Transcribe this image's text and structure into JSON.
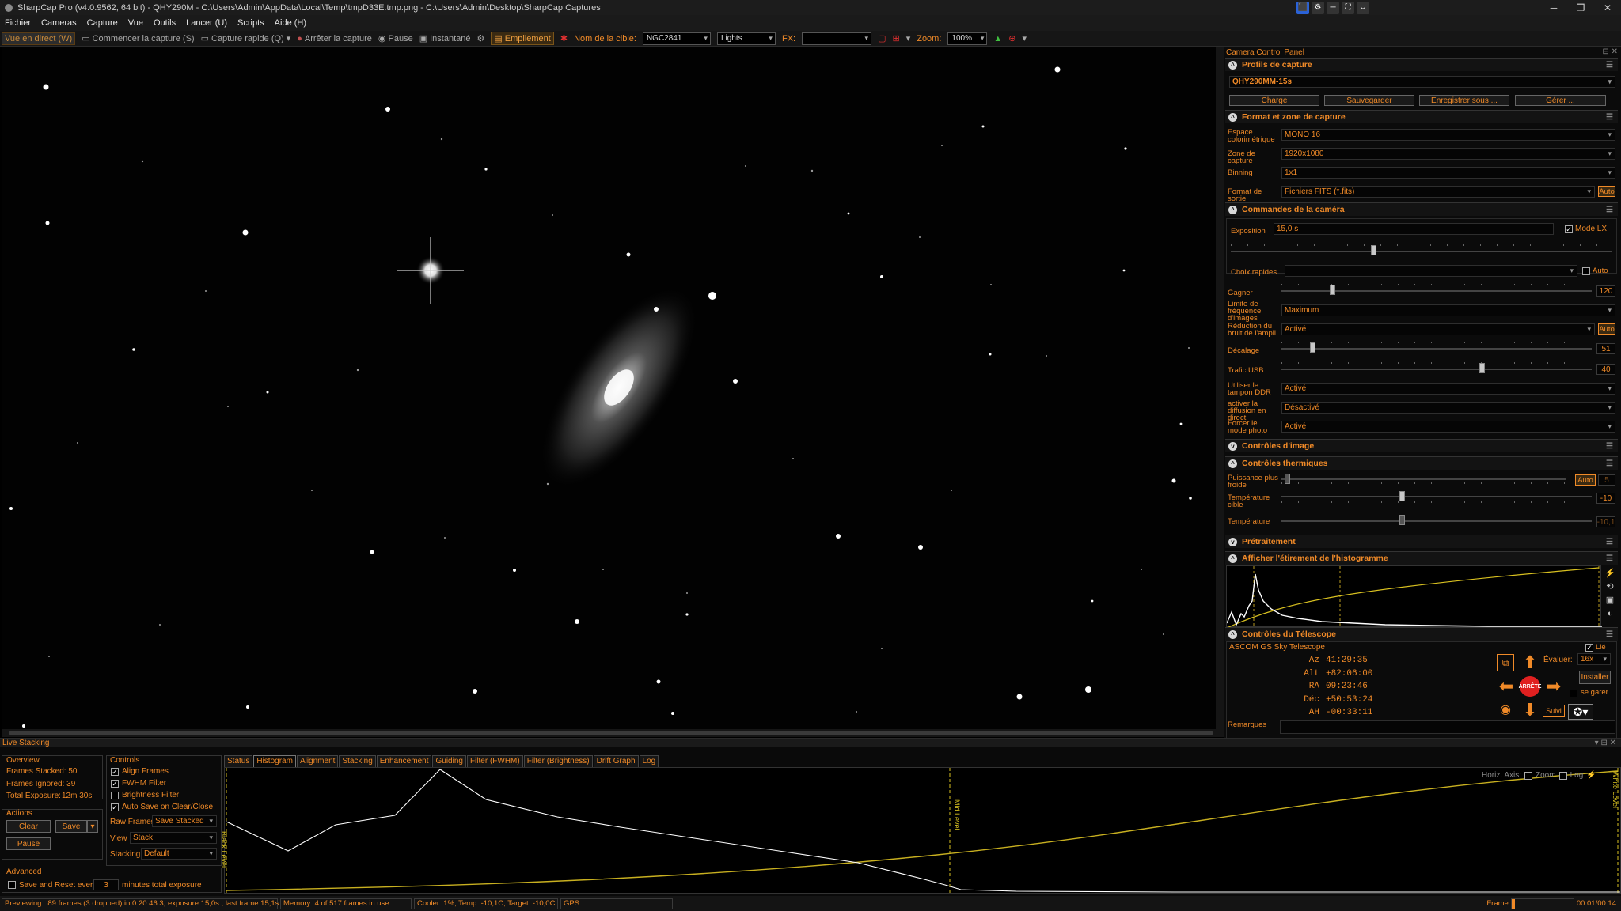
{
  "window": {
    "title": "SharpCap Pro (v4.0.9562, 64 bit) - QHY290M - C:\\Users\\Admin\\AppData\\Local\\Temp\\tmpD33E.tmp.png - C:\\Users\\Admin\\Desktop\\SharpCap Captures",
    "minimize": "─",
    "restore": "❐",
    "close": "✕"
  },
  "tray": [
    "⬛",
    "⚙",
    "─",
    "⛶",
    "⌄"
  ],
  "menu": [
    "Fichier",
    "Cameras",
    "Capture",
    "Vue",
    "Outils",
    "Lancer (U)",
    "Scripts",
    "Aide (H)"
  ],
  "toolbar": {
    "live_view": "Vue en direct (W)",
    "start_capture": "Commencer la capture (S)",
    "quick_capture": "Capture rapide (Q)",
    "stop_capture": "Arrêter la capture",
    "pause": "Pause",
    "snapshot": "Instantané",
    "stacking": "Empilement",
    "target_label": "Nom de la cible:",
    "target_value": "NGC2841",
    "frame_type": "Lights",
    "fx_label": "FX:",
    "fx_value": "",
    "zoom_label": "Zoom:",
    "zoom_value": "100%"
  },
  "panel": {
    "title": "Camera Control Panel",
    "profiles": {
      "header": "Profils de capture",
      "selected": "QHY290MM-15s",
      "buttons": [
        "Charge",
        "Sauvegarder",
        "Enregistrer sous ...",
        "Gérer ..."
      ]
    },
    "format": {
      "header": "Format et zone de capture",
      "rows": [
        {
          "label": "Espace colorimétrique",
          "value": "MONO 16"
        },
        {
          "label": "Zone de capture",
          "value": "1920x1080"
        },
        {
          "label": "Binning",
          "value": "1x1"
        },
        {
          "label": "Format de sortie",
          "value": "Fichiers FITS (*.fits)"
        }
      ],
      "auto": "Auto"
    },
    "camera": {
      "header": "Commandes de la caméra",
      "exposure_label": "Exposition",
      "exposure_value": "15,0 s",
      "lx_label": "Mode LX",
      "quick_label": "Choix rapides",
      "quick_auto": "Auto",
      "gain_label": "Gagner",
      "gain_value": "120",
      "framerate_label": "Limite de fréquence d'images",
      "framerate_value": "Maximum",
      "ampnoise_label": "Réduction du bruit de l'ampli",
      "ampnoise_value": "Activé",
      "ampnoise_auto": "Auto",
      "offset_label": "Décalage",
      "offset_value": "51",
      "usb_label": "Trafic USB",
      "usb_value": "40",
      "ddr_label": "Utiliser le tampon DDR",
      "ddr_value": "Activé",
      "stream_label": "activer la diffusion en direct",
      "stream_value": "Désactivé",
      "photo_label": "Forcer le mode photo",
      "photo_value": "Activé"
    },
    "image_controls": {
      "header": "Contrôles d'image"
    },
    "thermal": {
      "header": "Contrôles thermiques",
      "power_label": "Puissance plus froide",
      "power_auto": "Auto",
      "power_value": "5",
      "target_label": "Température cible",
      "target_value": "-10",
      "temp_label": "Température",
      "temp_value": "-10,1"
    },
    "preprocessing": {
      "header": "Prétraitement"
    },
    "histogram": {
      "header": "Afficher l'étirement de l'histogramme"
    },
    "telescope": {
      "header": "Contrôles du Télescope",
      "name": "ASCOM GS Sky Telescope",
      "linked": "Lié",
      "coords": [
        {
          "k": "Az",
          "v": "41:29:35"
        },
        {
          "k": "Alt",
          "v": "+82:06:00"
        },
        {
          "k": "RA",
          "v": "09:23:46"
        },
        {
          "k": "Déc",
          "v": "+50:53:24"
        },
        {
          "k": "AH",
          "v": "-00:33:11"
        }
      ],
      "rate_label": "Évaluer:",
      "rate_value": "16x",
      "install": "Installer",
      "park": "se garer",
      "stop": "ARRÊTE",
      "follow": "Suivi"
    },
    "remarks": "Remarques"
  },
  "live_stacking": {
    "title": "Live Stacking",
    "overview": {
      "header": "Overview",
      "stacked": "Frames Stacked: 50",
      "ignored": "Frames Ignored: 39",
      "exposure_label": "Total Exposure:",
      "exposure_value": "12m 30s"
    },
    "actions": {
      "header": "Actions",
      "clear": "Clear",
      "save": "Save",
      "pause": "Pause"
    },
    "advanced": {
      "header": "Advanced",
      "save_every": "Save and Reset every",
      "minutes_value": "3",
      "minutes": "minutes total exposure"
    },
    "controls": {
      "header": "Controls",
      "align": "Align Frames",
      "fwhm": "FWHM Filter",
      "brightness": "Brightness Filter",
      "autosave": "Auto Save on Clear/Close",
      "raw_label": "Raw Frames",
      "raw_value": "Save Stacked",
      "view_label": "View",
      "view_value": "Stack",
      "stacking_label": "Stacking",
      "stacking_value": "Default"
    },
    "tabs": [
      "Status",
      "Histogram",
      "Alignment",
      "Stacking",
      "Enhancement",
      "Guiding",
      "Filter (FWHM)",
      "Filter (Brightness)",
      "Drift Graph",
      "Log"
    ],
    "active_tab": "Histogram",
    "hist": {
      "horiz_axis": "Horiz. Axis:",
      "zoom": "Zoom",
      "log": "Log",
      "black_level": "Black Level",
      "mid_level": "Mid Level",
      "white_level": "White Level"
    }
  },
  "status": {
    "previewing": "Previewing : 89 frames (3 dropped) in 0:20:46.3, exposure 15,0s , last frame 15,1s",
    "memory": "Memory: 4 of 517 frames in use.",
    "cooler": "Cooler: 1%, Temp: -10,1C, Target: -10,0C",
    "gps": "GPS:",
    "frame_label": "Frame",
    "frame_time": "00:01/00:14"
  },
  "colors": {
    "accent": "#f08a28",
    "yellow": "#d8c020",
    "red": "#e02020"
  }
}
